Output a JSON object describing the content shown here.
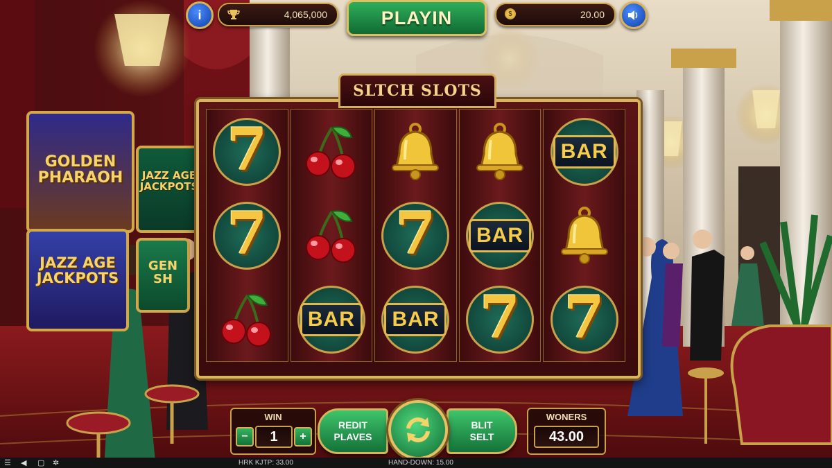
{
  "top_bar": {
    "info_label": "i",
    "jackpot_value": "4,065,000",
    "play_label": "PLAYIN",
    "balance_value": "20.00",
    "coin_label": "$"
  },
  "game": {
    "title": "SLTCH SLOTS",
    "reels": [
      [
        "seven",
        "seven",
        "cherry"
      ],
      [
        "cherry",
        "cherry",
        "bar"
      ],
      [
        "bell",
        "seven",
        "bar"
      ],
      [
        "bell",
        "bar",
        "seven"
      ],
      [
        "bar",
        "bell",
        "seven"
      ]
    ],
    "symbol_text": {
      "seven": "7",
      "bar": "BAR"
    }
  },
  "background": {
    "machine_left_top": "GOLDEN PHARAOH",
    "machine_left_bottom": "JAZZ AGE JACKPOTS",
    "machine_mid_top": "JAZZ AGE JACKPOTS",
    "machine_mid_bottom": "GEN SH"
  },
  "controls": {
    "win_label": "WIN",
    "win_value": "1",
    "minus_label": "−",
    "plus_label": "+",
    "left_button_line1": "REDIT",
    "left_button_line2": "PLAVES",
    "right_button_line1": "BLIT",
    "right_button_line2": "SELT",
    "woners_label": "WONERS",
    "woners_value": "43.00"
  },
  "status_bar": {
    "left_text": "HRK KJTP: 33.00",
    "center_text": "HAND-DOWN: 15.00"
  },
  "colors": {
    "gold": "#d8b45c",
    "felt_red": "#5a1416",
    "button_green": "#137238",
    "info_blue": "#0e3fa6"
  }
}
